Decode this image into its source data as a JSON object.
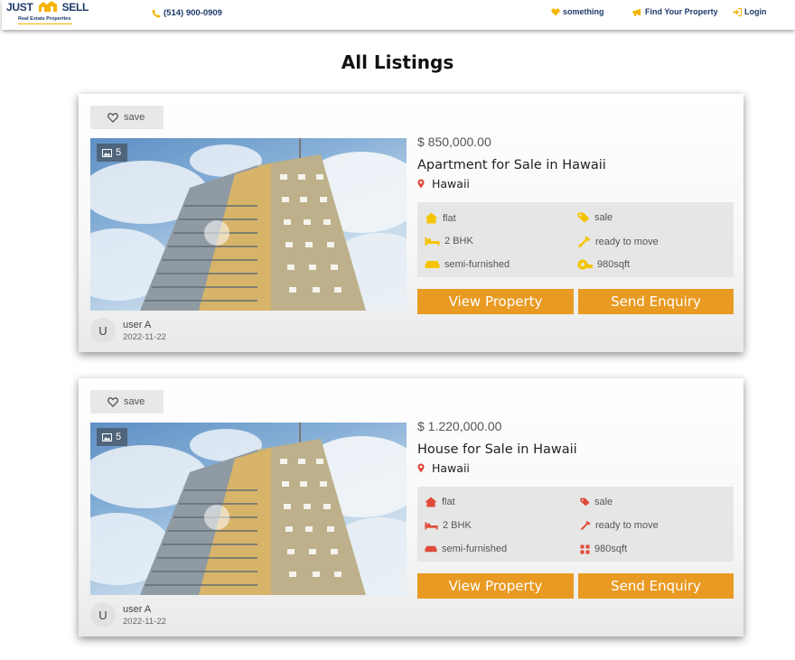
{
  "header": {
    "logo": {
      "left": "JUST",
      "right": "SELL",
      "sub": "Real Estate Properties"
    },
    "phone": "(514) 900-0909",
    "nav": {
      "something": "something",
      "find_property": "Find Your Property",
      "login": "Login"
    },
    "colors": {
      "navy": "#1d3a6b",
      "brand_yellow": "#f5b400"
    }
  },
  "page": {
    "title": "All Listings"
  },
  "listings": [
    {
      "save_label": "save",
      "photo_count": "5",
      "price": "$ 850,000.00",
      "title": "Apartment for Sale in Hawaii",
      "location": "Hawaii",
      "icon_color": "#f5c400",
      "features": {
        "type": "flat",
        "status": "sale",
        "bhk": "2 BHK",
        "readiness": "ready to move",
        "furnishing": "semi-furnished",
        "area": "980sqft"
      },
      "buttons": {
        "view": "View Property",
        "enquiry": "Send Enquiry"
      },
      "user": {
        "initial": "U",
        "name": "user A",
        "date": "2022-11-22"
      }
    },
    {
      "save_label": "save",
      "photo_count": "5",
      "price": "$ 1.220,000.00",
      "title": "House for Sale in Hawaii",
      "location": "Hawaii",
      "icon_color": "#e04a3a",
      "features": {
        "type": "flat",
        "status": "sale",
        "bhk": "2 BHK",
        "readiness": "ready to move",
        "furnishing": "semi-furnished",
        "area": "980sqft"
      },
      "buttons": {
        "view": "View Property",
        "enquiry": "Send Enquiry"
      },
      "user": {
        "initial": "U",
        "name": "user A",
        "date": "2022-11-22"
      }
    }
  ],
  "accent_colors": {
    "button": "#e99a22",
    "location_pin": "#e04a3a"
  }
}
